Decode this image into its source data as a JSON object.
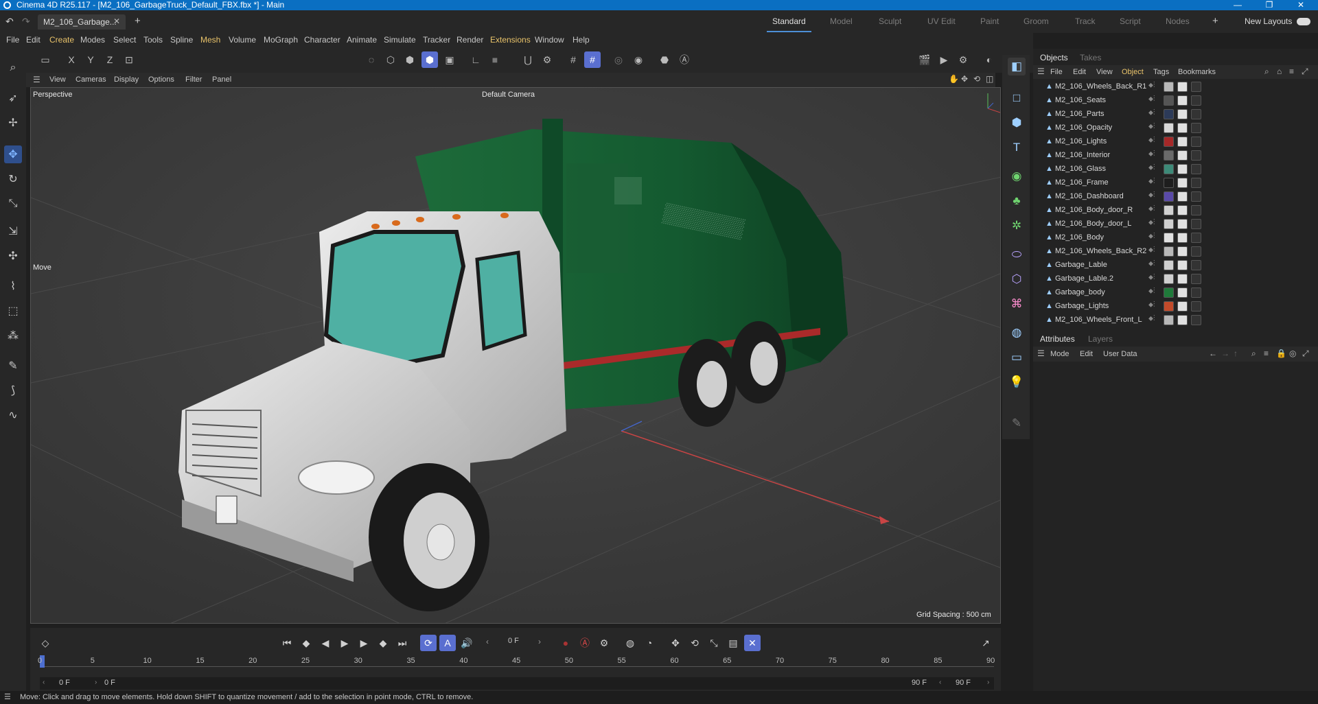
{
  "window": {
    "title": "Cinema 4D R25.117 - [M2_106_GarbageTruck_Default_FBX.fbx *] - Main",
    "minimize": "—",
    "maximize": "❐",
    "close": "✕"
  },
  "tabs": {
    "document": "M2_106_Garbage...",
    "layouts": [
      "Standard",
      "Model",
      "Sculpt",
      "UV Edit",
      "Paint",
      "Groom",
      "Track",
      "Script",
      "Nodes"
    ],
    "active_layout": "Standard",
    "new_layouts": "New Layouts"
  },
  "menubar": [
    "File",
    "Edit",
    "Create",
    "Modes",
    "Select",
    "Tools",
    "Spline",
    "Mesh",
    "Volume",
    "MoGraph",
    "Character",
    "Animate",
    "Simulate",
    "Tracker",
    "Render",
    "Extensions",
    "Window",
    "Help"
  ],
  "toolbar": {
    "axis_x": "X",
    "axis_y": "Y",
    "axis_z": "Z"
  },
  "viewport_menu": [
    "View",
    "Cameras",
    "Display",
    "Options",
    "Filter",
    "Panel"
  ],
  "viewport": {
    "projection": "Perspective",
    "camera": "Default Camera",
    "tool_label": "Move",
    "grid_spacing": "Grid Spacing : 500 cm"
  },
  "objects_panel": {
    "tabs": [
      "Objects",
      "Takes"
    ],
    "menu": [
      "File",
      "Edit",
      "View",
      "Object",
      "Tags",
      "Bookmarks"
    ],
    "items": [
      {
        "name": "M2_106_Wheels_Back_R1",
        "tag_color": "#b8b8b8"
      },
      {
        "name": "M2_106_Seats",
        "tag_color": "#555555"
      },
      {
        "name": "M2_106_Parts",
        "tag_color": "#2c3a58"
      },
      {
        "name": "M2_106_Opacity",
        "tag_color": "#d8d8d8"
      },
      {
        "name": "M2_106_Lights",
        "tag_color": "#a52828"
      },
      {
        "name": "M2_106_Interior",
        "tag_color": "#6a6a6a"
      },
      {
        "name": "M2_106_Glass",
        "tag_color": "#3d8a78"
      },
      {
        "name": "M2_106_Frame",
        "tag_color": "#1e1e1e"
      },
      {
        "name": "M2_106_Dashboard",
        "tag_color": "#5a4aa8"
      },
      {
        "name": "M2_106_Body_door_R",
        "tag_color": "#d0d0d0"
      },
      {
        "name": "M2_106_Body_door_L",
        "tag_color": "#d0d0d0"
      },
      {
        "name": "M2_106_Body",
        "tag_color": "#e0e0e0"
      },
      {
        "name": "M2_106_Wheels_Back_R2",
        "tag_color": "#b8b8b8"
      },
      {
        "name": "Garbage_Lable",
        "tag_color": "#cfcfcf"
      },
      {
        "name": "Garbage_Lable.2",
        "tag_color": "#cfcfcf"
      },
      {
        "name": "Garbage_body",
        "tag_color": "#1f7a3a"
      },
      {
        "name": "Garbage_Lights",
        "tag_color": "#c24a2a"
      },
      {
        "name": "M2_106_Wheels_Front_L",
        "tag_color": "#b8b8b8"
      }
    ]
  },
  "attributes_panel": {
    "tabs": [
      "Attributes",
      "Layers"
    ],
    "menu": [
      "Mode",
      "Edit",
      "User Data"
    ]
  },
  "timeline": {
    "current_frame": "0 F",
    "ticks": [
      "0",
      "5",
      "10",
      "15",
      "20",
      "25",
      "30",
      "35",
      "40",
      "45",
      "50",
      "55",
      "60",
      "65",
      "70",
      "75",
      "80",
      "85",
      "90"
    ],
    "range_start": "0 F",
    "range_start_inner": "0 F",
    "range_end_inner": "90 F",
    "range_end": "90 F"
  },
  "status": "Move: Click and drag to move elements. Hold down SHIFT to quantize movement / add to the selection in point mode, CTRL to remove.",
  "colors": {
    "accent": "#5a6fd0",
    "titlebar": "#0a6fc2",
    "truck_body": "#1f6b3c",
    "cab": "#d7d7d7"
  }
}
